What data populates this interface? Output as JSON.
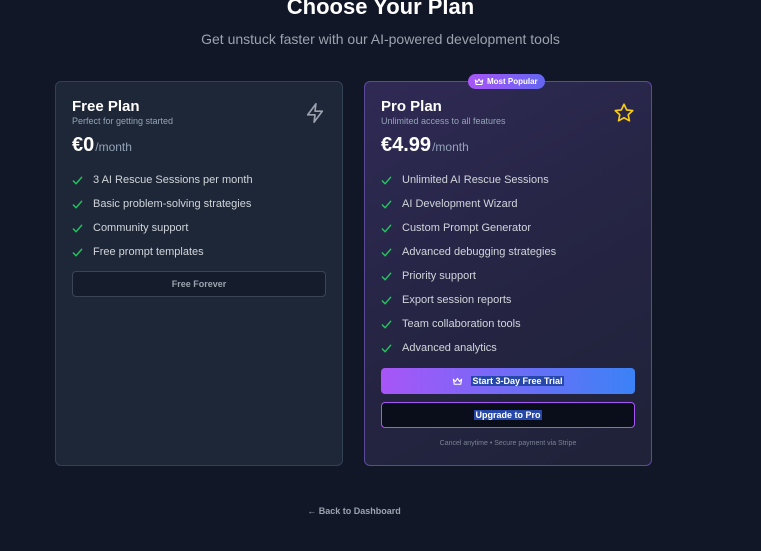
{
  "header": {
    "title": "Choose Your Plan",
    "subtitle": "Get unstuck faster with our AI-powered development tools"
  },
  "colors": {
    "background": "#111727",
    "check": "#22c55e",
    "accent_purple": "#a855f7",
    "accent_blue": "#3b82f6",
    "star": "#facc15"
  },
  "free_plan": {
    "name": "Free Plan",
    "description": "Perfect for getting started",
    "price": "€0",
    "period": "/month",
    "icon": "lightning-icon",
    "features": [
      "3 AI Rescue Sessions per month",
      "Basic problem-solving strategies",
      "Community support",
      "Free prompt templates"
    ],
    "button_label": "Free Forever"
  },
  "pro_plan": {
    "badge": "Most Popular",
    "badge_icon": "crown-icon",
    "name": "Pro Plan",
    "description": "Unlimited access to all features",
    "price": "€4.99",
    "period": "/month",
    "icon": "star-icon",
    "features": [
      "Unlimited AI Rescue Sessions",
      "AI Development Wizard",
      "Custom Prompt Generator",
      "Advanced debugging strategies",
      "Priority support",
      "Export session reports",
      "Team collaboration tools",
      "Advanced analytics"
    ],
    "trial_button_label": "Start 3-Day Free Trial",
    "upgrade_button_label": "Upgrade to Pro",
    "fineprint": "Cancel anytime • Secure payment via Stripe"
  },
  "footer": {
    "back_link": "← Back to Dashboard"
  }
}
